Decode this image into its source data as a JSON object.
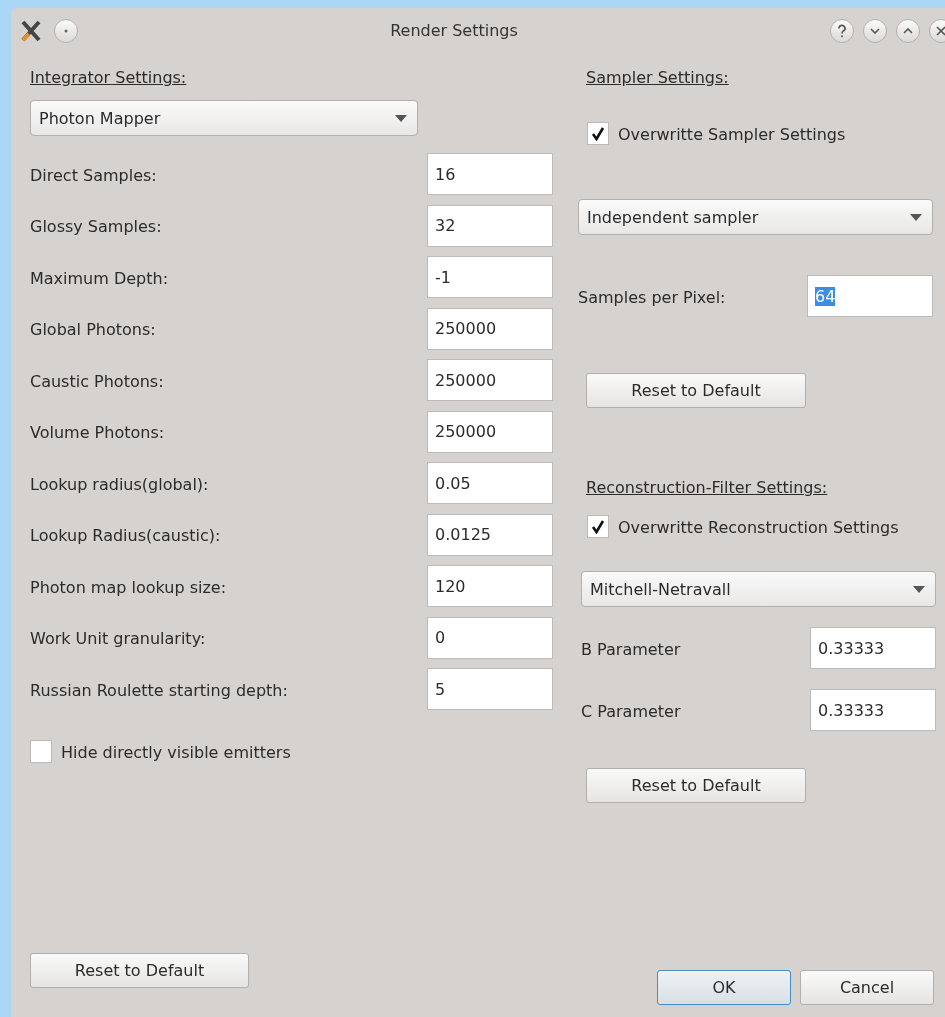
{
  "window": {
    "title": "Render Settings"
  },
  "integrator": {
    "heading": "Integrator Settings:",
    "dropdown": "Photon Mapper",
    "fields": [
      {
        "label": "Direct Samples:",
        "value": "16",
        "selected": false
      },
      {
        "label": "Glossy Samples:",
        "value": "32",
        "selected": false
      },
      {
        "label": "Maximum Depth:",
        "value": "-1",
        "selected": false
      },
      {
        "label": "Global Photons:",
        "value": "250000",
        "selected": false
      },
      {
        "label": "Caustic Photons:",
        "value": "250000",
        "selected": false
      },
      {
        "label": "Volume Photons:",
        "value": "250000",
        "selected": false
      },
      {
        "label": "Lookup radius(global):",
        "value": "0.05",
        "selected": false
      },
      {
        "label": "Lookup Radius(caustic):",
        "value": "0.0125",
        "selected": false
      },
      {
        "label": "Photon map lookup size:",
        "value": "120",
        "selected": false
      },
      {
        "label": "Work Unit granularity:",
        "value": "0",
        "selected": false
      },
      {
        "label": "Russian Roulette starting depth:",
        "value": "5",
        "selected": false
      }
    ],
    "checkbox": {
      "label": "Hide directly visible emitters",
      "checked": false
    },
    "reset": "Reset to Default"
  },
  "sampler": {
    "heading": "Sampler Settings:",
    "checkbox": {
      "label": "Overwritte Sampler Settings",
      "checked": true
    },
    "dropdown": "Independent sampler",
    "fields": [
      {
        "label": "Samples per Pixel:",
        "value": "64",
        "selected": true
      }
    ],
    "reset": "Reset to Default"
  },
  "reconstruction": {
    "heading": "Reconstruction-Filter Settings:",
    "checkbox": {
      "label": "Overwritte Reconstruction Settings",
      "checked": true
    },
    "dropdown": "Mitchell-Netravall",
    "fields": [
      {
        "label": "B Parameter",
        "value": "0.33333",
        "selected": false
      },
      {
        "label": "C Parameter",
        "value": "0.33333",
        "selected": false
      }
    ],
    "reset": "Reset to Default"
  },
  "buttons": [
    {
      "label": "OK",
      "default": true
    },
    {
      "label": "Cancel",
      "default": false
    }
  ]
}
